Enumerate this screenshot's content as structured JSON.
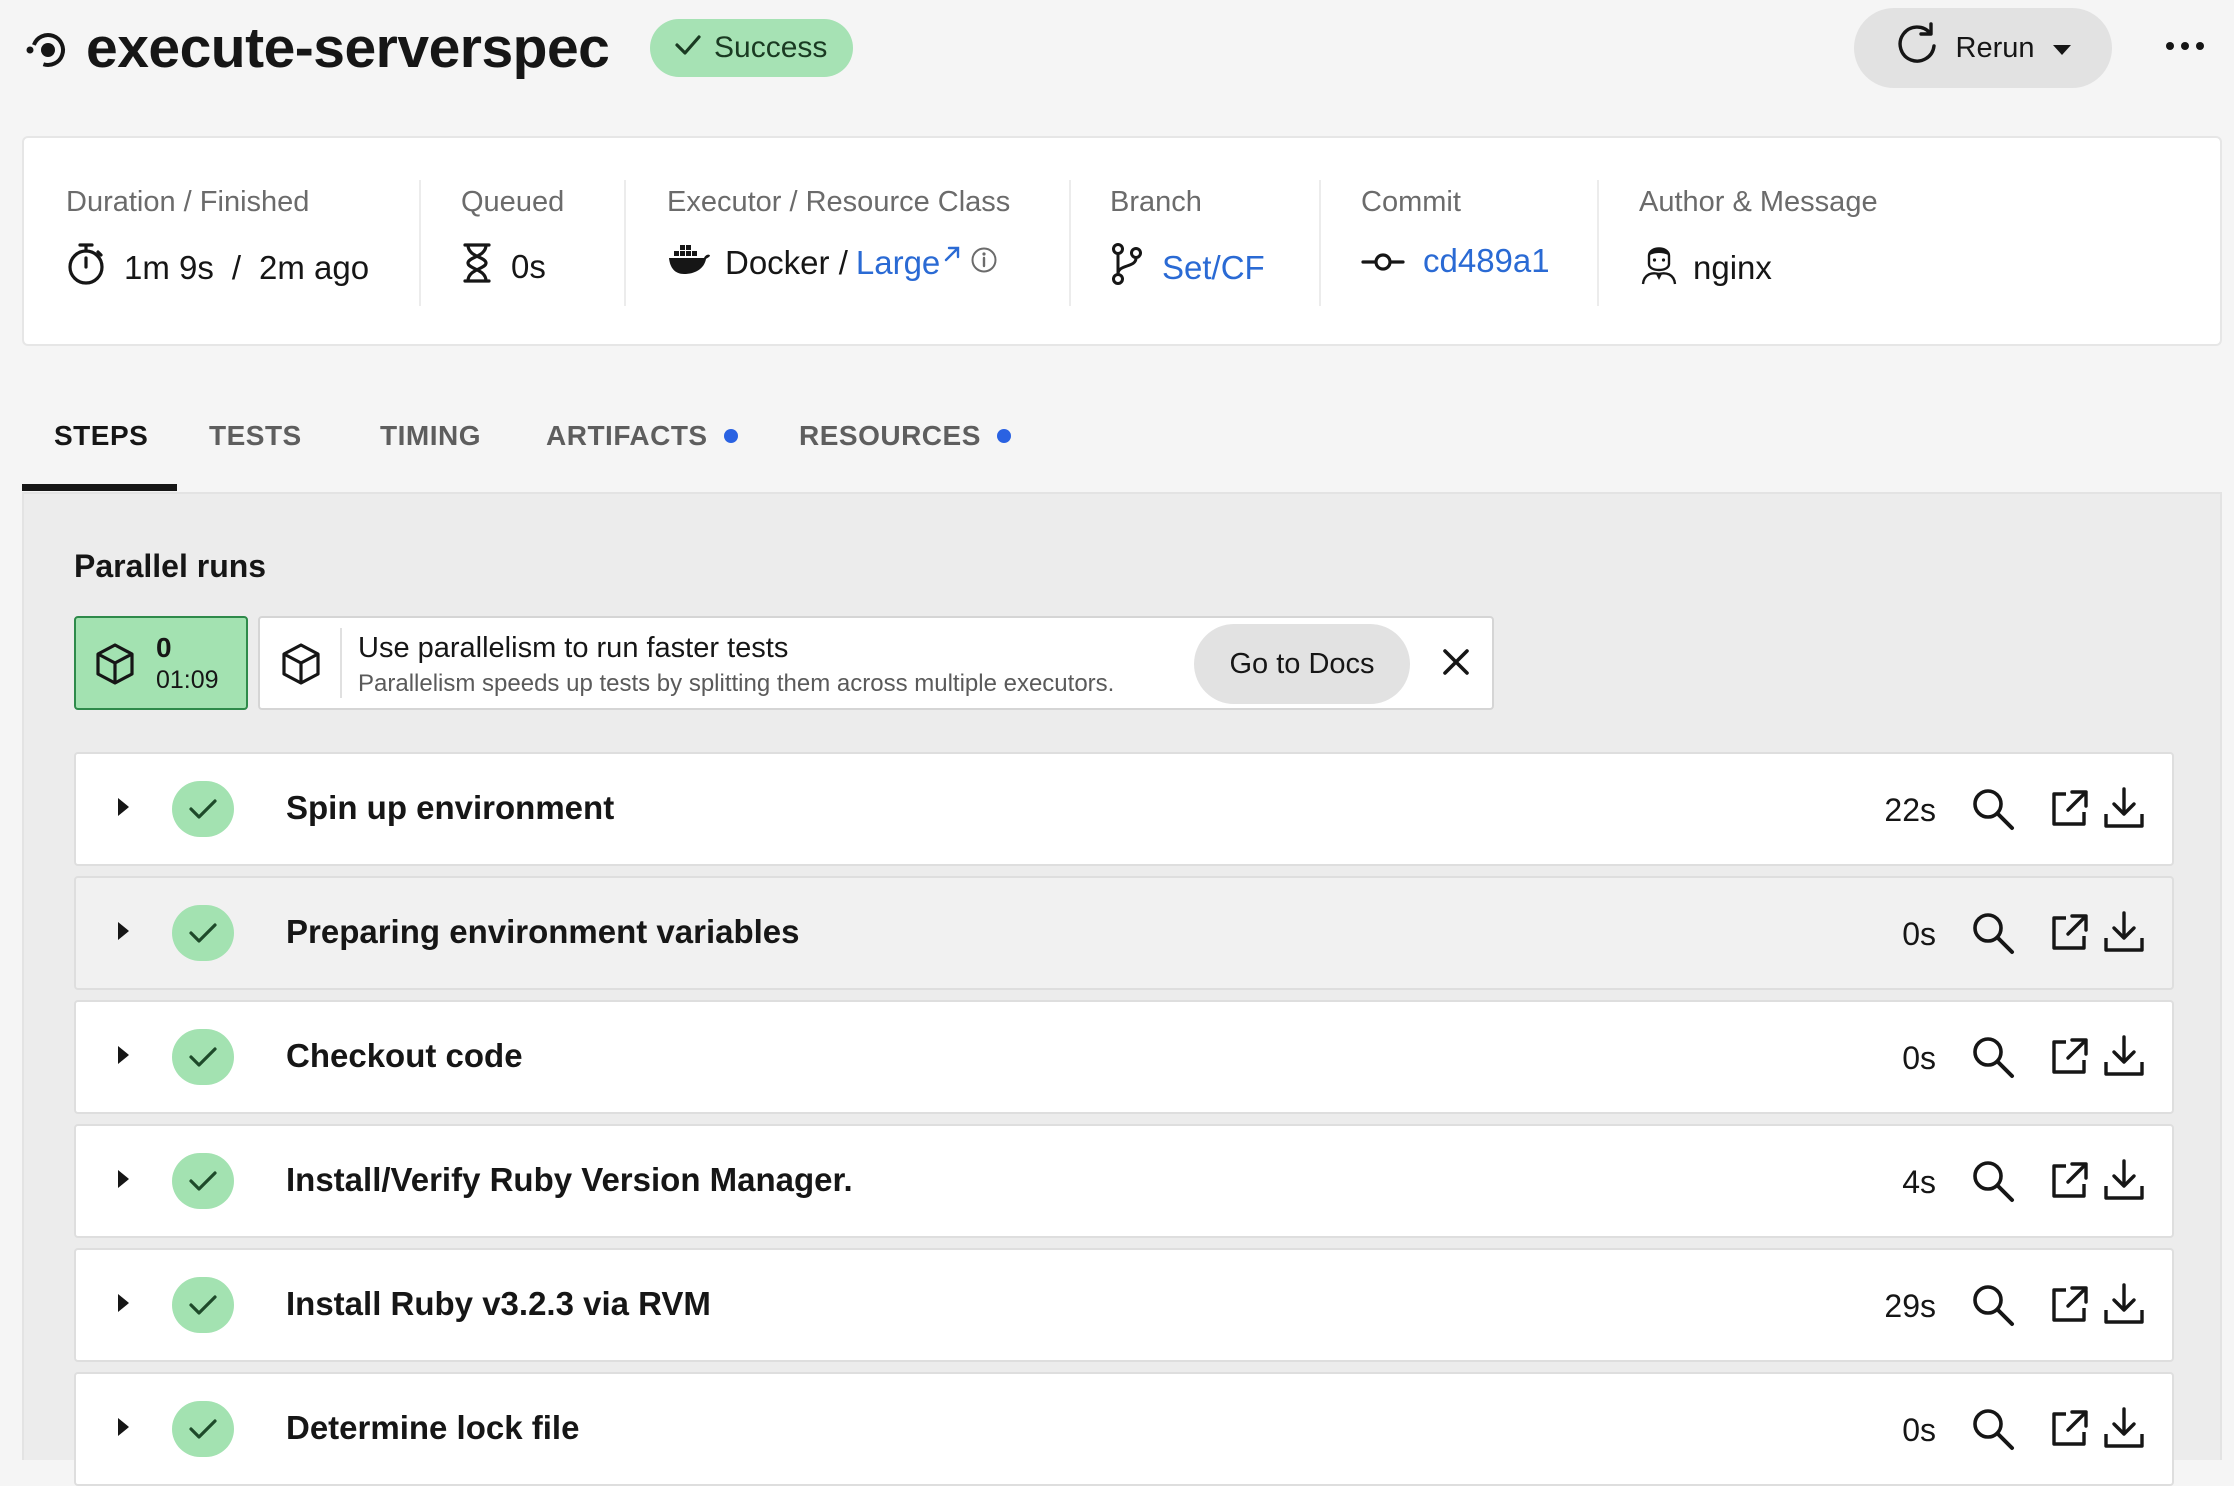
{
  "header": {
    "job_title": "execute-serverspec",
    "status": "Success",
    "rerun_label": "Rerun",
    "colors": {
      "success_badge": "#a6e2b4",
      "link": "#2a6ad4",
      "tab_dot": "#2a62e2"
    }
  },
  "info": {
    "duration_label": "Duration / Finished",
    "duration": "1m 9s",
    "sep": "/",
    "finished": "2m ago",
    "queued_label": "Queued",
    "queued": "0s",
    "executor_label": "Executor / Resource Class",
    "executor": "Docker /",
    "resource_class": "Large",
    "branch_label": "Branch",
    "branch": "Set/CF",
    "commit_label": "Commit",
    "commit": "cd489a1",
    "author_label": "Author & Message",
    "author": "nginx"
  },
  "tabs": [
    {
      "label": "STEPS",
      "active": true,
      "dot": false
    },
    {
      "label": "TESTS",
      "active": false,
      "dot": false
    },
    {
      "label": "TIMING",
      "active": false,
      "dot": false
    },
    {
      "label": "ARTIFACTS",
      "active": false,
      "dot": true
    },
    {
      "label": "RESOURCES",
      "active": false,
      "dot": true
    }
  ],
  "parallel": {
    "title": "Parallel runs",
    "index": "0",
    "time": "01:09",
    "promo_title": "Use parallelism to run faster tests",
    "promo_subtitle": "Parallelism speeds up tests by splitting them across multiple executors.",
    "docs_label": "Go to Docs"
  },
  "steps": [
    {
      "name": "Spin up environment",
      "duration": "22s"
    },
    {
      "name": "Preparing environment variables",
      "duration": "0s"
    },
    {
      "name": "Checkout code",
      "duration": "0s"
    },
    {
      "name": "Install/Verify Ruby Version Manager.",
      "duration": "4s"
    },
    {
      "name": "Install Ruby v3.2.3 via RVM",
      "duration": "29s"
    },
    {
      "name": "Determine lock file",
      "duration": "0s"
    }
  ],
  "icons": [
    "job-icon",
    "check-icon",
    "rerun-icon",
    "caret-down-icon",
    "more-icon",
    "stopwatch-icon",
    "hourglass-icon",
    "docker-icon",
    "external-link-icon",
    "info-icon",
    "branch-icon",
    "commit-icon",
    "avatar",
    "cube-icon",
    "close-icon",
    "expand-caret-icon",
    "search-icon",
    "open-external-icon",
    "download-icon"
  ]
}
